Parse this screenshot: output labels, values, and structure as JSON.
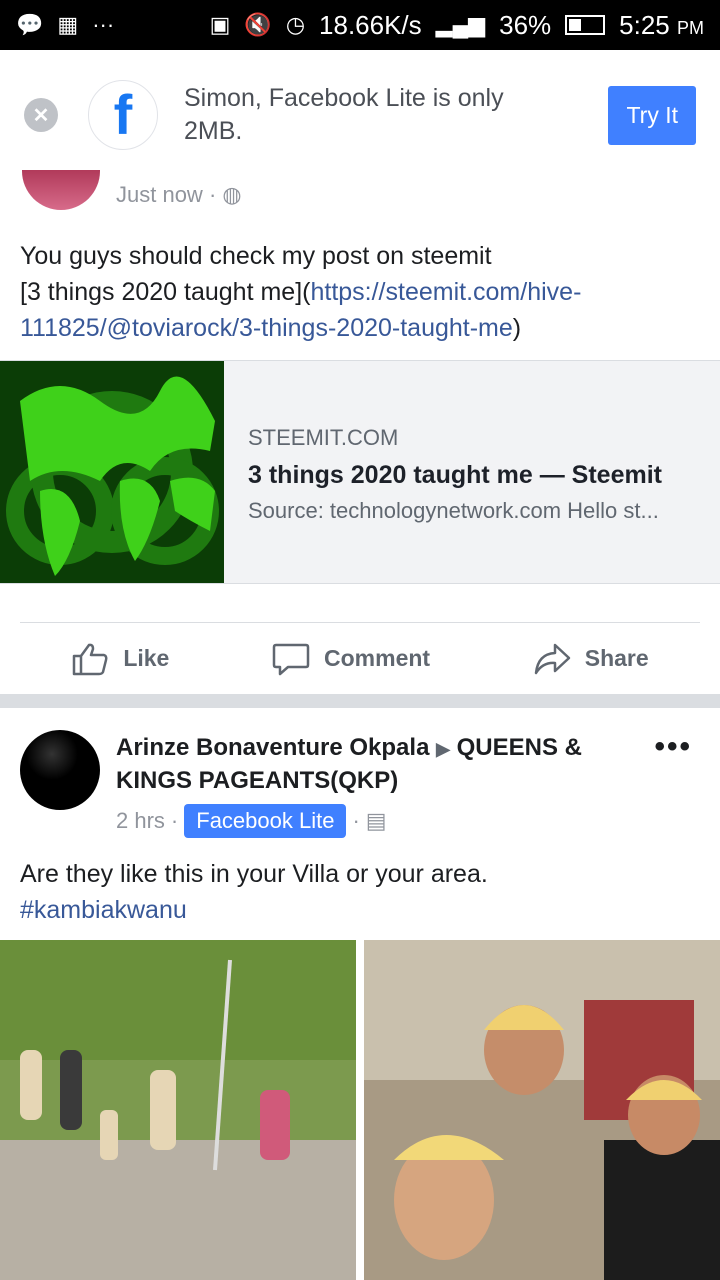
{
  "status_bar": {
    "speed": "18.66K/s",
    "battery": "36%",
    "time": "5:25",
    "ampm": "PM"
  },
  "banner": {
    "text": "Simon, Facebook Lite is only 2MB.",
    "button": "Try It"
  },
  "post1": {
    "time": "Just now",
    "text_line1": "You guys should check my post on steemit",
    "text_line2": "[3 things 2020 taught me](",
    "link_text": "https://steemit.com/hive-111825/@toviarock/3-things-2020-taught-me",
    "text_end": ")",
    "link_card": {
      "domain": "STEEMIT.COM",
      "title": "3 things 2020 taught me — Steemit",
      "description": "Source: technologynetwork.com Hello st..."
    },
    "actions": {
      "like": "Like",
      "comment": "Comment",
      "share": "Share"
    }
  },
  "post2": {
    "author": "Arinze Bonaventure Okpala",
    "group": "QUEENS & KINGS PAGEANTS(QKP)",
    "time": "2 hrs",
    "badge": "Facebook Lite",
    "text": "Are they like this in your Villa or your area.",
    "hashtag": "#kambiakwanu"
  }
}
